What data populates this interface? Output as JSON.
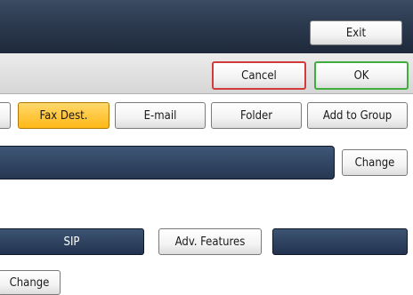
{
  "topbar": {
    "exit_label": "Exit"
  },
  "actions": {
    "cancel_label": "Cancel",
    "ok_label": "OK"
  },
  "tabs": [
    {
      "label": "",
      "selected": false
    },
    {
      "label": "Fax Dest.",
      "selected": true
    },
    {
      "label": "E-mail",
      "selected": false
    },
    {
      "label": "Folder",
      "selected": false
    },
    {
      "label": "Add to Group",
      "selected": false
    }
  ],
  "destination": {
    "value": "",
    "change_label": "Change"
  },
  "options": {
    "sip_label": "SIP",
    "adv_features_label": "Adv. Features",
    "blank_label": ""
  },
  "footer": {
    "change_label": "Change"
  },
  "colors": {
    "topbar": "#2c3a4f",
    "selected_tab": "#ffc533",
    "navy": "#2f4363",
    "cancel_border": "#d23b3b",
    "ok_border": "#3fae3f"
  }
}
